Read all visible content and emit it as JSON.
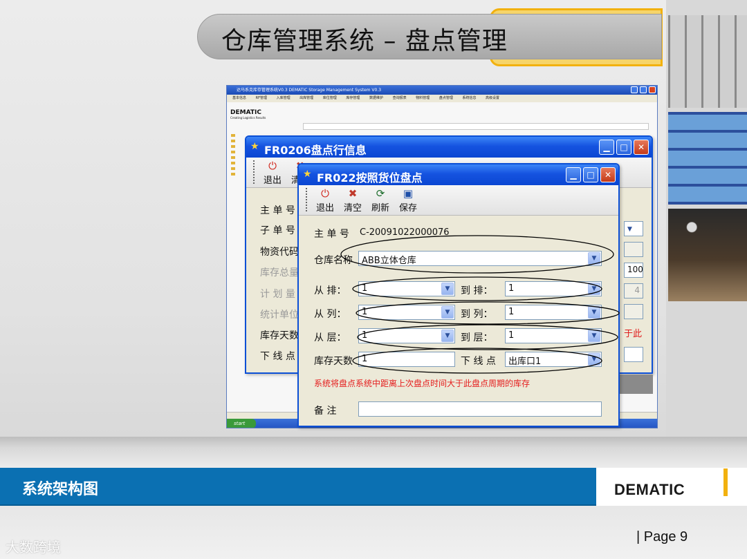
{
  "slide": {
    "title": "仓库管理系统 – 盘点管理",
    "footer_title": "系统架构图",
    "brand": "DEMATIC",
    "page_label": "|  Page   9",
    "watermark": "大数跨境"
  },
  "main_app": {
    "window_title": "达马系克库存管理系统V0.3 DEMATIC Storage Management System V0.3",
    "menu": [
      "基本信息",
      "RF管理",
      "入库管理",
      "出库管理",
      "库位管理",
      "库存管理",
      "数据维护",
      "查询报表",
      "物料管理",
      "盘点管理",
      "系统信息",
      "高级设置"
    ],
    "logo": "DEMATIC",
    "logo_sub": "Creating Logistics Results",
    "start": "start"
  },
  "window_fr0206": {
    "title": "FR0206盘点行信息",
    "toolbar": [
      {
        "label": "退出",
        "icon": "exit-icon"
      },
      {
        "label": "清空",
        "icon": "clear-icon"
      }
    ],
    "labels": [
      "主 单 号",
      "子 单 号",
      "物资代码",
      "库存总量",
      "计 划 量",
      "统计单位",
      "库存天数",
      "下 线 点"
    ],
    "value_total": "100",
    "value_plan": "4",
    "side_red": "于此"
  },
  "window_fr022": {
    "title": "FR022按照货位盘点",
    "toolbar": [
      {
        "label": "退出",
        "icon": "exit-icon"
      },
      {
        "label": "清空",
        "icon": "clear-icon"
      },
      {
        "label": "刷新",
        "icon": "refresh-icon"
      },
      {
        "label": "保存",
        "icon": "save-icon"
      }
    ],
    "main_no_label": "主 单 号",
    "main_no": "C-20091022000076",
    "warehouse_label": "仓库名称",
    "warehouse": "ABB立体仓库",
    "from_row_label": "从    排：",
    "from_row": "1",
    "to_row_label": "到    排：",
    "to_row": "1",
    "from_col_label": "从    列：",
    "from_col": "1",
    "to_col_label": "到    列：",
    "to_col": "1",
    "from_layer_label": "从    层：",
    "from_layer": "1",
    "to_layer_label": "到    层：",
    "to_layer": "1",
    "stock_days_label": "库存天数",
    "stock_days": "1",
    "offline_label": "下 线 点",
    "offline": "出库口1",
    "notice": "系统将盘点系统中距离上次盘点时间大于此盘点周期的库存",
    "remark_label": "备    注",
    "remark": ""
  },
  "colors": {
    "footer_blue": "#0b70b2",
    "accent_yellow": "#f2b10f",
    "xp_title_blue": "#1553e0",
    "notice_red": "#e51c1c"
  }
}
